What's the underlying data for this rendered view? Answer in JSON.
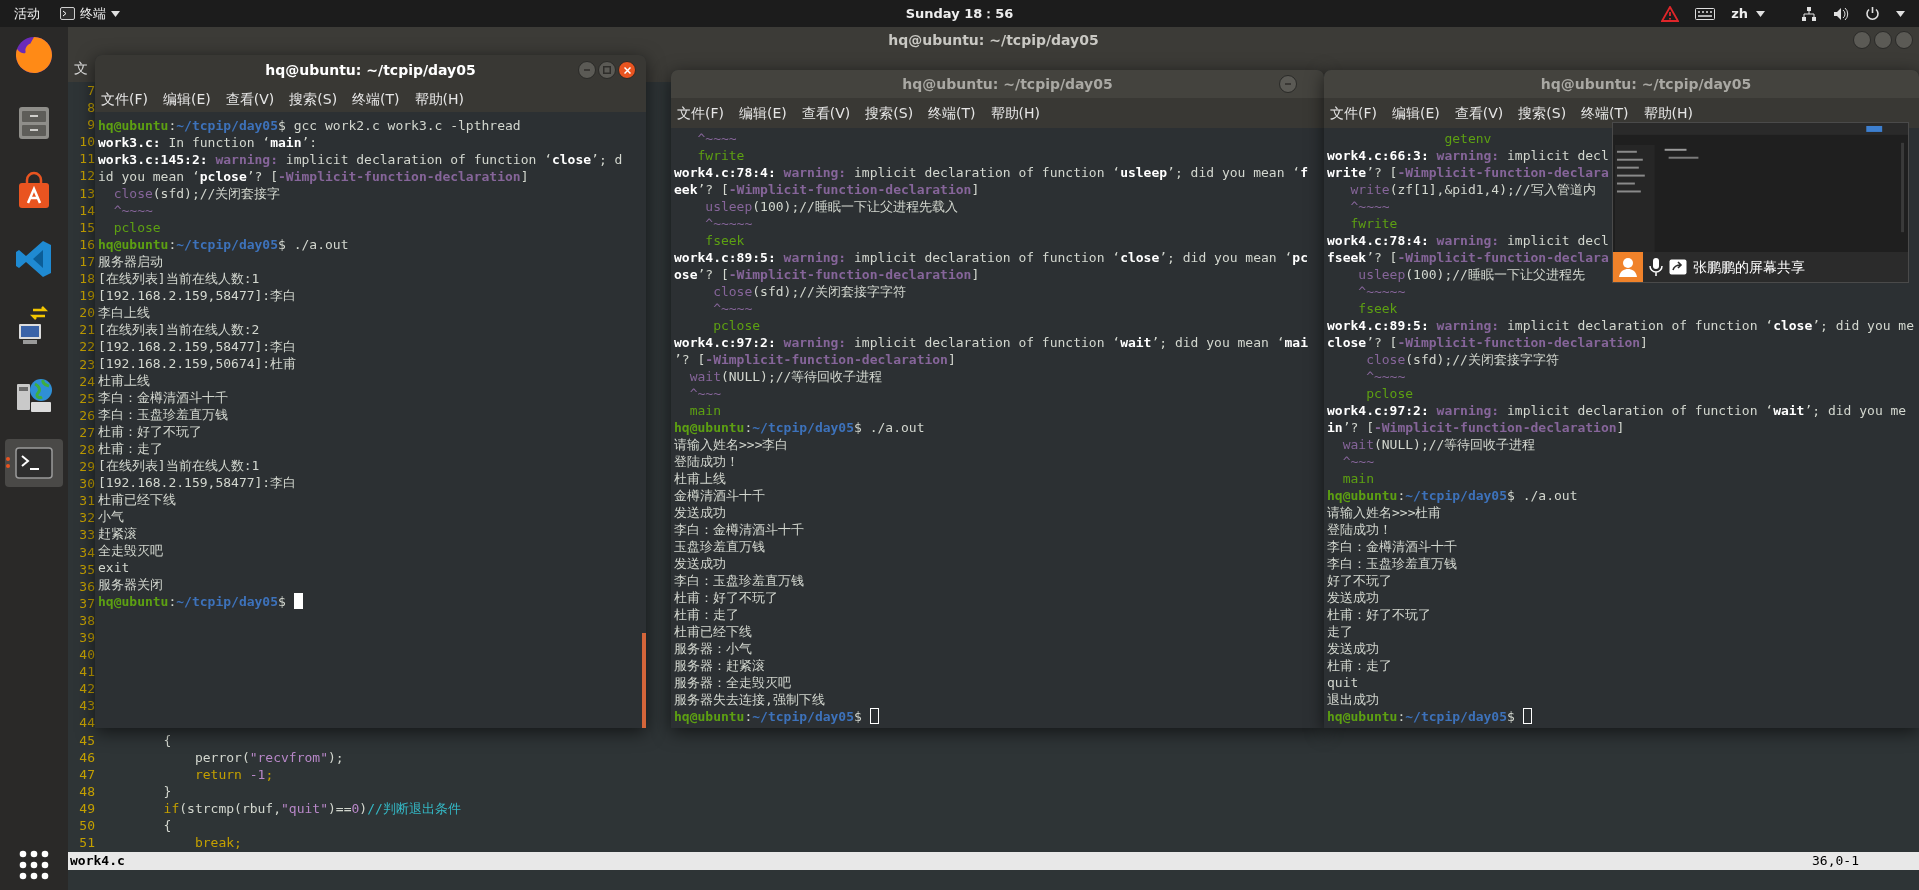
{
  "top_bar": {
    "activities": "活动",
    "app_menu": "终端",
    "clock": "Sunday 18：56",
    "input_method": "zh"
  },
  "dock": [
    {
      "kind": "browser",
      "active": false
    },
    {
      "kind": "files",
      "active": false
    },
    {
      "kind": "store",
      "active": false
    },
    {
      "kind": "editor",
      "active": false
    },
    {
      "kind": "network",
      "active": false
    },
    {
      "kind": "globe",
      "active": false
    },
    {
      "kind": "terminal",
      "active": true
    }
  ],
  "editor_window": {
    "title": "hq@ubuntu: ~/tcpip/day05",
    "focused": false,
    "menu": [
      "文"
    ],
    "lines": [
      {
        "number": "7"
      },
      {
        "number": "8"
      },
      {
        "number": "9"
      },
      {
        "number": "10"
      },
      {
        "number": "11"
      },
      {
        "number": "12"
      },
      {
        "number": "13"
      },
      {
        "number": "14"
      },
      {
        "number": "15"
      },
      {
        "number": "16"
      },
      {
        "number": "17"
      },
      {
        "number": "18"
      },
      {
        "number": "19"
      },
      {
        "number": "20"
      },
      {
        "number": "21"
      },
      {
        "number": "22"
      },
      {
        "number": "23"
      },
      {
        "number": "24"
      },
      {
        "number": "25"
      },
      {
        "number": "26"
      },
      {
        "number": "27"
      },
      {
        "number": "28"
      },
      {
        "number": "29"
      },
      {
        "number": "30"
      },
      {
        "number": "31"
      },
      {
        "number": "32"
      },
      {
        "number": "33"
      },
      {
        "number": "34"
      },
      {
        "number": "35"
      },
      {
        "number": "36"
      },
      {
        "number": "37"
      },
      {
        "number": "38"
      },
      {
        "number": "39"
      },
      {
        "number": "40"
      },
      {
        "number": "41"
      },
      {
        "number": "42"
      },
      {
        "number": "43"
      },
      {
        "number": "44"
      },
      {
        "number": "45",
        "segments": [
          {
            "kind": "plain",
            "text": "        {"
          }
        ]
      },
      {
        "number": "46",
        "segments": [
          {
            "kind": "plain",
            "text": "            perror("
          },
          {
            "kind": "string",
            "text": "\"recvfrom\""
          },
          {
            "kind": "plain",
            "text": ");"
          }
        ]
      },
      {
        "number": "47",
        "segments": [
          {
            "kind": "keyword",
            "text": "            return"
          },
          {
            "kind": "number",
            "text": " -1"
          },
          {
            "kind": "keyword",
            "text": ";"
          }
        ]
      },
      {
        "number": "48",
        "segments": [
          {
            "kind": "plain",
            "text": "        }"
          }
        ]
      },
      {
        "number": "49",
        "segments": [
          {
            "kind": "keyword",
            "text": "        if"
          },
          {
            "kind": "plain",
            "text": "(strcmp(rbuf,"
          },
          {
            "kind": "string",
            "text": "\"quit\""
          },
          {
            "kind": "plain",
            "text": ")=="
          },
          {
            "kind": "number",
            "text": "0"
          },
          {
            "kind": "plain",
            "text": ")"
          },
          {
            "kind": "comment",
            "text": "//判断退出条件"
          }
        ]
      },
      {
        "number": "50",
        "segments": [
          {
            "kind": "plain",
            "text": "        {"
          }
        ]
      },
      {
        "number": "51",
        "segments": [
          {
            "kind": "keyword",
            "text": "            break;"
          }
        ]
      }
    ],
    "status": {
      "file": "work4.c",
      "position": "36,0-1"
    }
  },
  "windows": [
    {
      "title": "hq@ubuntu: ~/tcpip/day05",
      "focused": true,
      "menu": [
        "文件(F)",
        "编辑(E)",
        "查看(V)",
        "搜索(S)",
        "终端(T)",
        "帮助(H)"
      ],
      "lines": [
        {
          "segments": [
            {
              "kind": "user",
              "text": "hq@ubuntu"
            },
            {
              "kind": "plain",
              "text": ":"
            },
            {
              "kind": "path",
              "text": "~/tcpip/day05"
            },
            {
              "kind": "plain",
              "text": "$ gcc work2.c work3.c -lpthread"
            }
          ]
        },
        {
          "segments": [
            {
              "kind": "bold",
              "text": "work3.c:"
            },
            {
              "kind": "plain",
              "text": " In function ‘"
            },
            {
              "kind": "bold",
              "text": "main"
            },
            {
              "kind": "plain",
              "text": "’:"
            }
          ]
        },
        {
          "segments": [
            {
              "kind": "bold",
              "text": "work3.c:145:2:"
            },
            {
              "kind": "warn",
              "text": " warning:"
            },
            {
              "kind": "plain",
              "text": " implicit declaration of function ‘"
            },
            {
              "kind": "bold",
              "text": "close"
            },
            {
              "kind": "plain",
              "text": "’; d"
            }
          ]
        },
        {
          "segments": [
            {
              "kind": "plain",
              "text": "id you mean ‘"
            },
            {
              "kind": "bold",
              "text": "pclose"
            },
            {
              "kind": "plain",
              "text": "’? ["
            },
            {
              "kind": "flag",
              "text": "-Wimplicit-function-declaration"
            },
            {
              "kind": "plain",
              "text": "]"
            }
          ]
        },
        {
          "segments": [
            {
              "kind": "mark",
              "text": "  close"
            },
            {
              "kind": "plain",
              "text": "(sfd);//关闭套接字"
            }
          ]
        },
        {
          "segments": [
            {
              "kind": "mark",
              "text": "  ^~~~~"
            }
          ]
        },
        {
          "segments": [
            {
              "kind": "hint",
              "text": "  pclose"
            }
          ]
        },
        {
          "segments": [
            {
              "kind": "user",
              "text": "hq@ubuntu"
            },
            {
              "kind": "plain",
              "text": ":"
            },
            {
              "kind": "path",
              "text": "~/tcpip/day05"
            },
            {
              "kind": "plain",
              "text": "$ ./a.out"
            }
          ]
        },
        {
          "text": "服务器启动"
        },
        {
          "text": "[在线列表]当前在线人数:1"
        },
        {
          "text": "[192.168.2.159,58477]:李白"
        },
        {
          "text": "李白上线"
        },
        {
          "text": "[在线列表]当前在线人数:2"
        },
        {
          "text": "[192.168.2.159,58477]:李白"
        },
        {
          "text": "[192.168.2.159,50674]:杜甫"
        },
        {
          "text": "杜甫上线"
        },
        {
          "text": "李白：金樽清酒斗十千"
        },
        {
          "text": "李白：玉盘珍羞直万钱"
        },
        {
          "text": "杜甫：好了不玩了"
        },
        {
          "text": "杜甫：走了"
        },
        {
          "text": "[在线列表]当前在线人数:1"
        },
        {
          "text": "[192.168.2.159,58477]:李白"
        },
        {
          "text": "杜甫已经下线"
        },
        {
          "text": "小气"
        },
        {
          "text": "赶紧滚"
        },
        {
          "text": "全走毁灭吧"
        },
        {
          "text": "exit"
        },
        {
          "text": "服务器关闭"
        },
        {
          "segments": [
            {
              "kind": "user",
              "text": "hq@ubuntu"
            },
            {
              "kind": "plain",
              "text": ":"
            },
            {
              "kind": "path",
              "text": "~/tcpip/day05"
            },
            {
              "kind": "plain",
              "text": "$ "
            },
            {
              "kind": "cursor"
            }
          ]
        }
      ]
    },
    {
      "title": "hq@ubuntu: ~/tcpip/day05",
      "focused": false,
      "menu": [
        "文件(F)",
        "编辑(E)",
        "查看(V)",
        "搜索(S)",
        "终端(T)",
        "帮助(H)"
      ],
      "lines": [
        {
          "segments": [
            {
              "kind": "mark",
              "text": "   ^~~~~"
            }
          ]
        },
        {
          "segments": [
            {
              "kind": "hint",
              "text": "   fwrite"
            }
          ]
        },
        {
          "segments": [
            {
              "kind": "bold",
              "text": "work4.c:78:4:"
            },
            {
              "kind": "warn",
              "text": " warning:"
            },
            {
              "kind": "plain",
              "text": " implicit declaration of function ‘"
            },
            {
              "kind": "bold",
              "text": "usleep"
            },
            {
              "kind": "plain",
              "text": "’; did you mean ‘"
            },
            {
              "kind": "bold",
              "text": "f"
            }
          ]
        },
        {
          "segments": [
            {
              "kind": "bold",
              "text": "eek"
            },
            {
              "kind": "plain",
              "text": "’? ["
            },
            {
              "kind": "flag",
              "text": "-Wimplicit-function-declaration"
            },
            {
              "kind": "plain",
              "text": "]"
            }
          ]
        },
        {
          "segments": [
            {
              "kind": "mark",
              "text": "    usleep"
            },
            {
              "kind": "plain",
              "text": "(100);//睡眠一下让父进程先载入"
            }
          ]
        },
        {
          "segments": [
            {
              "kind": "mark",
              "text": "    ^~~~~~"
            }
          ]
        },
        {
          "segments": [
            {
              "kind": "hint",
              "text": "    fseek"
            }
          ]
        },
        {
          "segments": [
            {
              "kind": "bold",
              "text": "work4.c:89:5:"
            },
            {
              "kind": "warn",
              "text": " warning:"
            },
            {
              "kind": "plain",
              "text": " implicit declaration of function ‘"
            },
            {
              "kind": "bold",
              "text": "close"
            },
            {
              "kind": "plain",
              "text": "’; did you mean ‘"
            },
            {
              "kind": "bold",
              "text": "pc"
            }
          ]
        },
        {
          "segments": [
            {
              "kind": "bold",
              "text": "ose"
            },
            {
              "kind": "plain",
              "text": "’? ["
            },
            {
              "kind": "flag",
              "text": "-Wimplicit-function-declaration"
            },
            {
              "kind": "plain",
              "text": "]"
            }
          ]
        },
        {
          "segments": [
            {
              "kind": "mark",
              "text": "     close"
            },
            {
              "kind": "plain",
              "text": "(sfd);//关闭套接字字符"
            }
          ]
        },
        {
          "segments": [
            {
              "kind": "mark",
              "text": "     ^~~~~"
            }
          ]
        },
        {
          "segments": [
            {
              "kind": "hint",
              "text": "     pclose"
            }
          ]
        },
        {
          "segments": [
            {
              "kind": "bold",
              "text": "work4.c:97:2:"
            },
            {
              "kind": "warn",
              "text": " warning:"
            },
            {
              "kind": "plain",
              "text": " implicit declaration of function ‘"
            },
            {
              "kind": "bold",
              "text": "wait"
            },
            {
              "kind": "plain",
              "text": "’; did you mean ‘"
            },
            {
              "kind": "bold",
              "text": "mai"
            }
          ]
        },
        {
          "segments": [
            {
              "kind": "plain",
              "text": "’? ["
            },
            {
              "kind": "flag",
              "text": "-Wimplicit-function-declaration"
            },
            {
              "kind": "plain",
              "text": "]"
            }
          ]
        },
        {
          "segments": [
            {
              "kind": "mark",
              "text": "  wait"
            },
            {
              "kind": "plain",
              "text": "(NULL);//等待回收子进程"
            }
          ]
        },
        {
          "segments": [
            {
              "kind": "mark",
              "text": "  ^~~~"
            }
          ]
        },
        {
          "segments": [
            {
              "kind": "hint",
              "text": "  main"
            }
          ]
        },
        {
          "segments": [
            {
              "kind": "user",
              "text": "hq@ubuntu"
            },
            {
              "kind": "plain",
              "text": ":"
            },
            {
              "kind": "path",
              "text": "~/tcpip/day05"
            },
            {
              "kind": "plain",
              "text": "$ ./a.out"
            }
          ]
        },
        {
          "text": "请输入姓名>>>李白"
        },
        {
          "text": "登陆成功！"
        },
        {
          "text": "杜甫上线"
        },
        {
          "text": "金樽清酒斗十千"
        },
        {
          "text": "发送成功"
        },
        {
          "text": "李白：金樽清酒斗十千"
        },
        {
          "text": "玉盘珍羞直万钱"
        },
        {
          "text": "发送成功"
        },
        {
          "text": "李白：玉盘珍羞直万钱"
        },
        {
          "text": "杜甫：好了不玩了"
        },
        {
          "text": "杜甫：走了"
        },
        {
          "text": "杜甫已经下线"
        },
        {
          "text": "服务器：小气"
        },
        {
          "text": "服务器：赶紧滚"
        },
        {
          "text": "服务器：全走毁灭吧"
        },
        {
          "text": "服务器失去连接,强制下线"
        },
        {
          "segments": [
            {
              "kind": "user",
              "text": "hq@ubuntu"
            },
            {
              "kind": "plain",
              "text": ":"
            },
            {
              "kind": "path",
              "text": "~/tcpip/day05"
            },
            {
              "kind": "plain",
              "text": "$ "
            },
            {
              "kind": "cursor"
            }
          ]
        }
      ]
    },
    {
      "title": "hq@ubuntu: ~/tcpip/day05",
      "focused": false,
      "menu": [
        "文件(F)",
        "编辑(E)",
        "查看(V)",
        "搜索(S)",
        "终端(T)",
        "帮助(H)"
      ],
      "lines": [
        {
          "segments": [
            {
              "kind": "hint",
              "text": "               getenv"
            }
          ]
        },
        {
          "segments": [
            {
              "kind": "bold",
              "text": "work4.c:66:3:"
            },
            {
              "kind": "warn",
              "text": " warning:"
            },
            {
              "kind": "plain",
              "text": " implicit decl"
            }
          ]
        },
        {
          "segments": [
            {
              "kind": "bold",
              "text": "write"
            },
            {
              "kind": "plain",
              "text": "’? ["
            },
            {
              "kind": "flag",
              "text": "-Wimplicit-function-declara"
            }
          ]
        },
        {
          "segments": [
            {
              "kind": "mark",
              "text": "   write"
            },
            {
              "kind": "plain",
              "text": "(zf[1],&pid1,4);//写入管道内"
            }
          ]
        },
        {
          "segments": [
            {
              "kind": "mark",
              "text": "   ^~~~~"
            }
          ]
        },
        {
          "segments": [
            {
              "kind": "hint",
              "text": "   fwrite"
            }
          ]
        },
        {
          "segments": [
            {
              "kind": "bold",
              "text": "work4.c:78:4:"
            },
            {
              "kind": "warn",
              "text": " warning:"
            },
            {
              "kind": "plain",
              "text": " implicit decl"
            }
          ]
        },
        {
          "segments": [
            {
              "kind": "bold",
              "text": "fseek"
            },
            {
              "kind": "plain",
              "text": "’? ["
            },
            {
              "kind": "flag",
              "text": "-Wimplicit-function-declara"
            }
          ]
        },
        {
          "segments": [
            {
              "kind": "mark",
              "text": "    usleep"
            },
            {
              "kind": "plain",
              "text": "(100);//睡眠一下让父进程先"
            }
          ]
        },
        {
          "segments": [
            {
              "kind": "mark",
              "text": "    ^~~~~~"
            }
          ]
        },
        {
          "segments": [
            {
              "kind": "hint",
              "text": "    fseek"
            }
          ]
        },
        {
          "segments": [
            {
              "kind": "bold",
              "text": "work4.c:89:5:"
            },
            {
              "kind": "warn",
              "text": " warning:"
            },
            {
              "kind": "plain",
              "text": " implicit declaration of function ‘"
            },
            {
              "kind": "bold",
              "text": "close"
            },
            {
              "kind": "plain",
              "text": "’; did you me"
            }
          ]
        },
        {
          "segments": [
            {
              "kind": "bold",
              "text": "close"
            },
            {
              "kind": "plain",
              "text": "’? ["
            },
            {
              "kind": "flag",
              "text": "-Wimplicit-function-declaration"
            },
            {
              "kind": "plain",
              "text": "]"
            }
          ]
        },
        {
          "segments": [
            {
              "kind": "mark",
              "text": "     close"
            },
            {
              "kind": "plain",
              "text": "(sfd);//关闭套接字字符"
            }
          ]
        },
        {
          "segments": [
            {
              "kind": "mark",
              "text": "     ^~~~~"
            }
          ]
        },
        {
          "segments": [
            {
              "kind": "hint",
              "text": "     pclose"
            }
          ]
        },
        {
          "segments": [
            {
              "kind": "bold",
              "text": "work4.c:97:2:"
            },
            {
              "kind": "warn",
              "text": " warning:"
            },
            {
              "kind": "plain",
              "text": " implicit declaration of function ‘"
            },
            {
              "kind": "bold",
              "text": "wait"
            },
            {
              "kind": "plain",
              "text": "’; did you me"
            }
          ]
        },
        {
          "segments": [
            {
              "kind": "bold",
              "text": "in"
            },
            {
              "kind": "plain",
              "text": "’? ["
            },
            {
              "kind": "flag",
              "text": "-Wimplicit-function-declaration"
            },
            {
              "kind": "plain",
              "text": "]"
            }
          ]
        },
        {
          "segments": [
            {
              "kind": "mark",
              "text": "  wait"
            },
            {
              "kind": "plain",
              "text": "(NULL);//等待回收子进程"
            }
          ]
        },
        {
          "segments": [
            {
              "kind": "mark",
              "text": "  ^~~~"
            }
          ]
        },
        {
          "segments": [
            {
              "kind": "hint",
              "text": "  main"
            }
          ]
        },
        {
          "segments": [
            {
              "kind": "user",
              "text": "hq@ubuntu"
            },
            {
              "kind": "plain",
              "text": ":"
            },
            {
              "kind": "path",
              "text": "~/tcpip/day05"
            },
            {
              "kind": "plain",
              "text": "$ ./a.out"
            }
          ]
        },
        {
          "text": "请输入姓名>>>杜甫"
        },
        {
          "text": "登陆成功！"
        },
        {
          "text": "李白：金樽清酒斗十千"
        },
        {
          "text": "李白：玉盘珍羞直万钱"
        },
        {
          "text": "好了不玩了"
        },
        {
          "text": "发送成功"
        },
        {
          "text": "杜甫：好了不玩了"
        },
        {
          "text": "走了"
        },
        {
          "text": "发送成功"
        },
        {
          "text": "杜甫：走了"
        },
        {
          "text": "quit"
        },
        {
          "text": "退出成功"
        },
        {
          "segments": [
            {
              "kind": "user",
              "text": "hq@ubuntu"
            },
            {
              "kind": "plain",
              "text": ":"
            },
            {
              "kind": "path",
              "text": "~/tcpip/day05"
            },
            {
              "kind": "plain",
              "text": "$ "
            },
            {
              "kind": "cursor"
            }
          ]
        }
      ]
    }
  ],
  "screen_share": {
    "label": "张鹏鹏的屏幕共享"
  }
}
